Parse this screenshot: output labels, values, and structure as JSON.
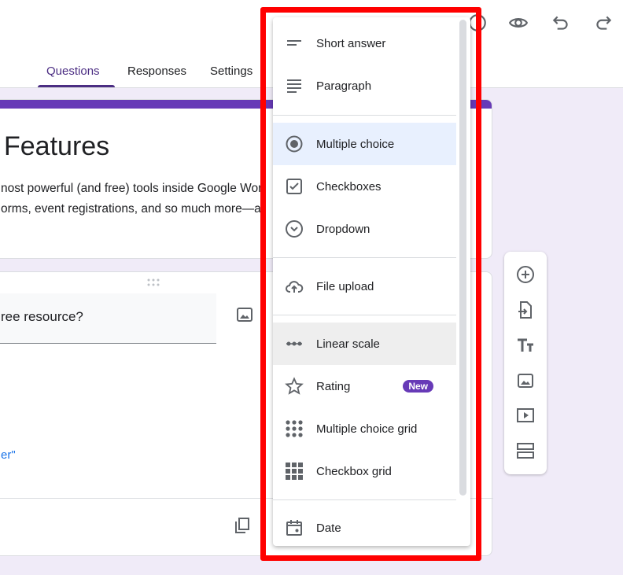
{
  "tabs": [
    {
      "label": "Questions",
      "active": true
    },
    {
      "label": "Responses"
    },
    {
      "label": "Settings"
    }
  ],
  "form": {
    "title": "Features",
    "description_line1": "nost powerful (and free) tools inside Google Wor",
    "description_line2": "orms, event registrations, and so much more—all"
  },
  "question": {
    "title": "ree resource?",
    "link_text": "er\""
  },
  "menu": {
    "items": [
      {
        "label": "Short answer",
        "icon": "short-text-icon"
      },
      {
        "label": "Paragraph",
        "icon": "paragraph-icon"
      },
      {
        "label": "Multiple choice",
        "icon": "radio-button-icon",
        "selected": true
      },
      {
        "label": "Checkboxes",
        "icon": "checkbox-icon"
      },
      {
        "label": "Dropdown",
        "icon": "dropdown-icon"
      },
      {
        "label": "File upload",
        "icon": "cloud-upload-icon"
      },
      {
        "label": "Linear scale",
        "icon": "linear-scale-icon",
        "hovered": true
      },
      {
        "label": "Rating",
        "icon": "star-icon",
        "badge": "New"
      },
      {
        "label": "Multiple choice grid",
        "icon": "dot-grid-icon"
      },
      {
        "label": "Checkbox grid",
        "icon": "square-grid-icon"
      },
      {
        "label": "Date",
        "icon": "calendar-icon"
      }
    ]
  },
  "colors": {
    "accent": "#673ab7",
    "highlight": "#ff0000",
    "link": "#1a73e8"
  }
}
